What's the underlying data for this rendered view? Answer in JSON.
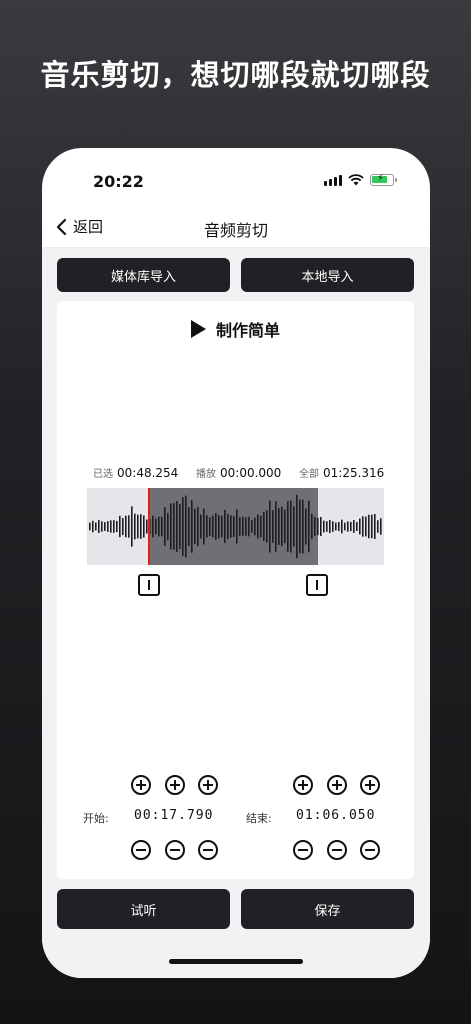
{
  "headline": "音乐剪切，想切哪段就切哪段",
  "status_bar": {
    "time": "20:22"
  },
  "nav": {
    "back_label": "返回",
    "title": "音频剪切"
  },
  "import_buttons": {
    "media_library": "媒体库导入",
    "local": "本地导入"
  },
  "player": {
    "title": "制作简单"
  },
  "timing": {
    "selected_label": "已选",
    "selected_value": "00:48.254",
    "play_label": "播放",
    "play_value": "00:00.000",
    "total_label": "全部",
    "total_value": "01:25.316"
  },
  "trim": {
    "start_label": "开始:",
    "start_value": "00:17.790",
    "end_label": "结束:",
    "end_value": "01:06.050"
  },
  "actions": {
    "preview": "试听",
    "save": "保存"
  },
  "colors": {
    "accent_cursor": "#e0201a",
    "button_dark": "#202124",
    "selection": "#6f6f75"
  }
}
